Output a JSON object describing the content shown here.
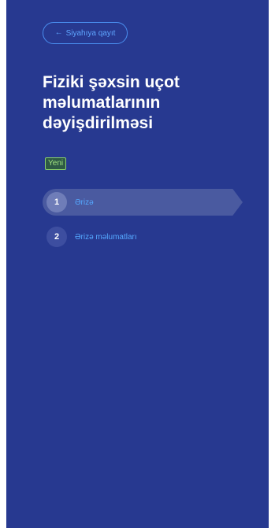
{
  "back_button": {
    "label": "Siyahıya qayıt",
    "arrow": "←"
  },
  "page": {
    "title": "Fiziki şəxsin uçot məlumatlarının dəyişdirilməsi"
  },
  "status": {
    "badge": "Yeni",
    "badge_color": "#9fe07f"
  },
  "steps": [
    {
      "number": "1",
      "label": "Ərizə",
      "active": true
    },
    {
      "number": "2",
      "label": "Ərizə məlumatları",
      "active": false
    }
  ],
  "colors": {
    "panel_bg": "#273990",
    "accent": "#55a8ff",
    "active_step_bg": "#4a5aa0"
  }
}
